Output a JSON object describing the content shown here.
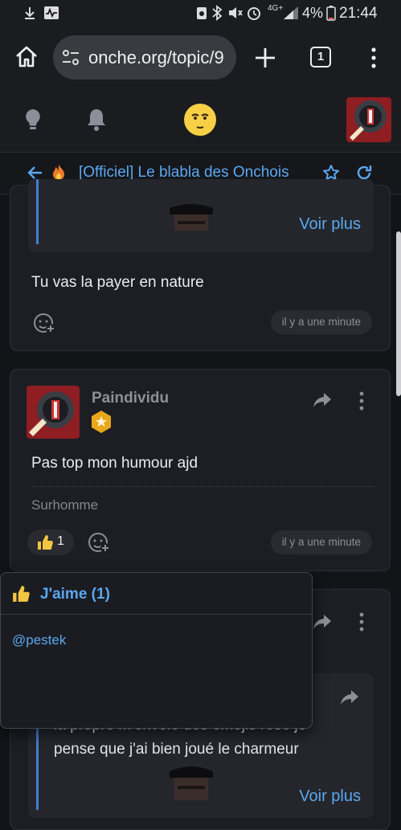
{
  "status_bar": {
    "network": "4G+",
    "battery": "4%",
    "time": "21:44"
  },
  "browser": {
    "url": "onche.org/topic/9",
    "tab_count": "1"
  },
  "topic": {
    "title": "[Officiel] Le blabla des Onchois"
  },
  "posts": [
    {
      "quote_more": "Voir plus",
      "text": "Tu vas la payer en nature",
      "time": "il y a une minute"
    },
    {
      "author": "Paindividu",
      "text": "Pas top mon humour ajd",
      "signature": "Surhomme",
      "likes": "1",
      "time": "il y a une minute"
    },
    {
      "quote_line1": "la propre m'envoie des émojis rose je",
      "quote_line2": "pense que j'ai bien joué le charmeur",
      "quote_more": "Voir plus"
    }
  ],
  "likes_popup": {
    "title": "J'aime (1)",
    "users": [
      "@pestek"
    ]
  },
  "colors": {
    "accent": "#5aa8f0",
    "background": "#131418",
    "card": "#1d1e23",
    "badge": "#e9a81c"
  }
}
